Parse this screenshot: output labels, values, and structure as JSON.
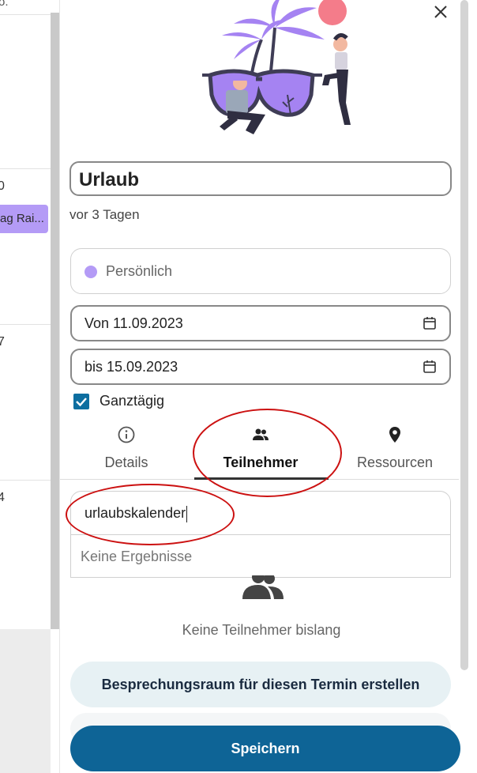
{
  "background_calendar": {
    "top_text": "o.",
    "day_labels": [
      "0",
      "7",
      "4"
    ],
    "event_label": "ag Rai...",
    "event_color": "#b49bf6"
  },
  "event": {
    "title": "Urlaub",
    "relative_time": "vor 3 Tagen",
    "calendar_name": "Persönlich",
    "calendar_color": "#b49bf6",
    "start_date": "Von 11.09.2023",
    "end_date": "bis 15.09.2023",
    "all_day_label": "Ganztägig",
    "all_day_checked": true
  },
  "tabs": [
    {
      "label": "Details",
      "icon": "info-icon",
      "active": false
    },
    {
      "label": "Teilnehmer",
      "icon": "people-icon",
      "active": true
    },
    {
      "label": "Ressourcen",
      "icon": "location-pin-icon",
      "active": false
    }
  ],
  "participants": {
    "search_value": "urlaubskalender",
    "no_results": "Keine Ergebnisse",
    "empty_text": "Keine Teilnehmer bislang"
  },
  "buttons": {
    "create_room": "Besprechungsraum für diesen Termin erstellen",
    "save": "Speichern"
  },
  "colors": {
    "primary": "#0e6496",
    "secondary_bg": "#e7f1f4",
    "accent_purple": "#b49bf6",
    "annotation_red": "#cc1111"
  }
}
